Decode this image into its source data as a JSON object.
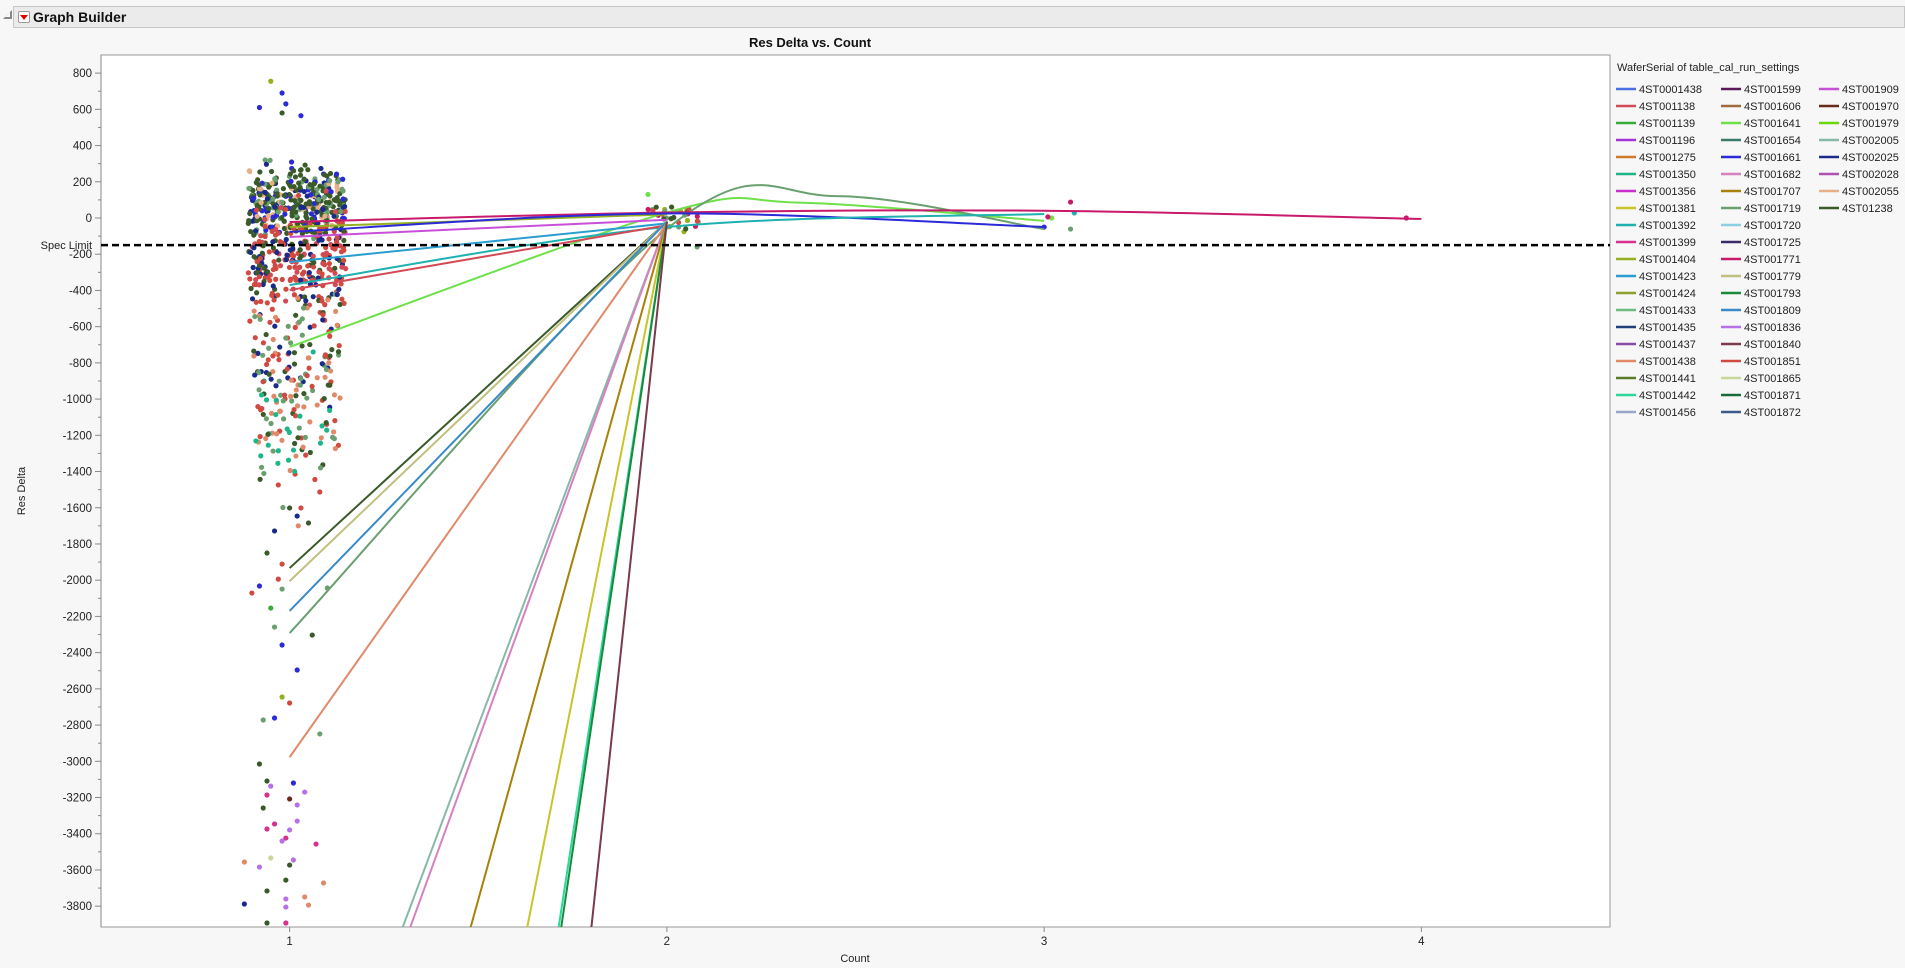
{
  "header": {
    "title": "Graph Builder"
  },
  "chart_data": {
    "type": "scatter",
    "title": "Res Delta vs. Count",
    "xlabel": "Count",
    "ylabel": "Res Delta",
    "xlim": [
      0.5,
      4.5
    ],
    "ylim": [
      -3915,
      900
    ],
    "x_ticks": [
      1,
      2,
      3,
      4
    ],
    "y_ticks": [
      800,
      600,
      400,
      200,
      0,
      -200,
      -400,
      -600,
      -800,
      -1000,
      -1200,
      -1400,
      -1600,
      -1800,
      -2000,
      -2200,
      -2400,
      -2600,
      -2800,
      -3000,
      -3200,
      -3400,
      -3600,
      -3800
    ],
    "grid": false,
    "reference_line": {
      "label": "Spec Limit",
      "y": -150,
      "style": "dashed",
      "color": "#000000"
    },
    "legend": {
      "title": "WaferSerial of table_cal_run_settings",
      "placement": "right",
      "items": [
        {
          "name": "4ST0001438",
          "color": "#4a6fe0"
        },
        {
          "name": "4ST001138",
          "color": "#d24a55"
        },
        {
          "name": "4ST001139",
          "color": "#3aaa3a"
        },
        {
          "name": "4ST001196",
          "color": "#a233d8"
        },
        {
          "name": "4ST001275",
          "color": "#d0782a"
        },
        {
          "name": "4ST001350",
          "color": "#1fb58a"
        },
        {
          "name": "4ST001356",
          "color": "#c92fc9"
        },
        {
          "name": "4ST001381",
          "color": "#c8c42a"
        },
        {
          "name": "4ST001392",
          "color": "#1fb0b0"
        },
        {
          "name": "4ST001399",
          "color": "#d8308f"
        },
        {
          "name": "4ST001404",
          "color": "#94b020"
        },
        {
          "name": "4ST001423",
          "color": "#2a9ed0"
        },
        {
          "name": "4ST001424",
          "color": "#8ea02a"
        },
        {
          "name": "4ST001433",
          "color": "#6dbb80"
        },
        {
          "name": "4ST001435",
          "color": "#1f3f7a"
        },
        {
          "name": "4ST001437",
          "color": "#8a4aa8"
        },
        {
          "name": "4ST001438",
          "color": "#e08a6a"
        },
        {
          "name": "4ST001441",
          "color": "#5a7a2a"
        },
        {
          "name": "4ST001442",
          "color": "#2ad89a"
        },
        {
          "name": "4ST001456",
          "color": "#9aa6c8"
        },
        {
          "name": "4ST001599",
          "color": "#5a1a5a"
        },
        {
          "name": "4ST001606",
          "color": "#a06a3a"
        },
        {
          "name": "4ST001641",
          "color": "#6ee04a"
        },
        {
          "name": "4ST001654",
          "color": "#3a7a6a"
        },
        {
          "name": "4ST001661",
          "color": "#2a2ad8"
        },
        {
          "name": "4ST001682",
          "color": "#d880c0"
        },
        {
          "name": "4ST001707",
          "color": "#a8800a"
        },
        {
          "name": "4ST001719",
          "color": "#6aa070"
        },
        {
          "name": "4ST001720",
          "color": "#8ad0e0"
        },
        {
          "name": "4ST001725",
          "color": "#3a2a6a"
        },
        {
          "name": "4ST001771",
          "color": "#c81a6a"
        },
        {
          "name": "4ST001779",
          "color": "#c0c080"
        },
        {
          "name": "4ST001793",
          "color": "#1a8a3a"
        },
        {
          "name": "4ST001809",
          "color": "#3a8ac8"
        },
        {
          "name": "4ST001836",
          "color": "#b870e8"
        },
        {
          "name": "4ST001840",
          "color": "#7a3a4a"
        },
        {
          "name": "4ST001851",
          "color": "#d04a40"
        },
        {
          "name": "4ST001865",
          "color": "#c8d898"
        },
        {
          "name": "4ST001871",
          "color": "#1a6a3a"
        },
        {
          "name": "4ST001872",
          "color": "#3a5a8a"
        },
        {
          "name": "4ST001909",
          "color": "#c850d8"
        },
        {
          "name": "4ST001970",
          "color": "#6a2a1a"
        },
        {
          "name": "4ST001979",
          "color": "#6ad80a"
        },
        {
          "name": "4ST002005",
          "color": "#88b8a8"
        },
        {
          "name": "4ST002025",
          "color": "#1a2a8a"
        },
        {
          "name": "4ST002028",
          "color": "#b050b0"
        },
        {
          "name": "4ST002055",
          "color": "#e8b088"
        },
        {
          "name": "4ST01238",
          "color": "#3a5a2a"
        }
      ]
    },
    "series_lines": [
      {
        "name": "4ST001641",
        "x": [
          1,
          2,
          2.35,
          3
        ],
        "y": [
          -712,
          30,
          85,
          -16
        ]
      },
      {
        "name": "4ST001719",
        "x": [
          1,
          2,
          2.45,
          3
        ],
        "y": [
          -2292,
          -60,
          121,
          -61
        ]
      },
      {
        "name": "4ST001771",
        "x": [
          1,
          2,
          3,
          4
        ],
        "y": [
          -22,
          30,
          40,
          -5
        ]
      },
      {
        "name": "4ST001404",
        "x": [
          1,
          2
        ],
        "y": [
          -50,
          20
        ]
      },
      {
        "name": "4ST001661",
        "x": [
          1,
          2,
          3
        ],
        "y": [
          -77,
          25,
          -50
        ]
      },
      {
        "name": "4ST001909",
        "x": [
          1,
          2
        ],
        "y": [
          -105,
          -10
        ]
      },
      {
        "name": "4ST001423",
        "x": [
          1,
          2
        ],
        "y": [
          -243,
          -30
        ]
      },
      {
        "name": "4ST001392",
        "x": [
          1,
          2,
          3
        ],
        "y": [
          -370,
          -50,
          22
        ]
      },
      {
        "name": "4ST001138",
        "x": [
          1,
          2
        ],
        "y": [
          -398,
          -40
        ]
      },
      {
        "name": "4ST01238",
        "x": [
          1,
          2
        ],
        "y": [
          -1933,
          -20
        ]
      },
      {
        "name": "4ST001779",
        "x": [
          1,
          2
        ],
        "y": [
          -2005,
          -20
        ]
      },
      {
        "name": "4ST001809",
        "x": [
          1,
          2
        ],
        "y": [
          -2170,
          -20
        ]
      },
      {
        "name": "4ST001438",
        "x": [
          1,
          2
        ],
        "y": [
          -2977,
          -30
        ]
      },
      {
        "name": "4ST002005",
        "x": [
          1,
          2
        ],
        "y": [
          -5584,
          -20
        ]
      },
      {
        "name": "4ST001682",
        "x": [
          1,
          2
        ],
        "y": [
          -5748,
          -20
        ]
      },
      {
        "name": "4ST001707",
        "x": [
          1,
          2
        ],
        "y": [
          -7510,
          -20
        ]
      },
      {
        "name": "4ST001381",
        "x": [
          1,
          2
        ],
        "y": [
          -10547,
          -20
        ]
      },
      {
        "name": "4ST001442",
        "x": [
          1,
          2
        ],
        "y": [
          -13600,
          -20
        ]
      },
      {
        "name": "4ST001793",
        "x": [
          1,
          2
        ],
        "y": [
          -13930,
          -20
        ]
      },
      {
        "name": "4ST001840",
        "x": [
          1,
          2
        ],
        "y": [
          -19495,
          -20
        ]
      }
    ],
    "point_clusters": [
      {
        "x": 1,
        "x_jitter": 0.13,
        "y_mean": 80,
        "y_sd": 90,
        "n": 360,
        "series": [
          "4ST01238",
          "4ST01238",
          "4ST01238",
          "4ST001661",
          "4ST002055",
          "4ST001719",
          "4ST002025"
        ]
      },
      {
        "x": 1,
        "x_jitter": 0.13,
        "y_mean": -250,
        "y_sd": 150,
        "n": 260,
        "series": [
          "4ST001851",
          "4ST01238",
          "4ST002025",
          "4ST001138",
          "4ST001851"
        ]
      },
      {
        "x": 1,
        "x_jitter": 0.12,
        "y_mean": -700,
        "y_sd": 200,
        "n": 120,
        "series": [
          "4ST002025",
          "4ST01238",
          "4ST001851",
          "4ST001719",
          "4ST001438"
        ]
      },
      {
        "x": 1,
        "x_jitter": 0.11,
        "y_mean": -1150,
        "y_sd": 200,
        "n": 90,
        "series": [
          "4ST001851",
          "4ST001438",
          "4ST001719",
          "4ST01238",
          "4ST001350"
        ]
      },
      {
        "x": 2,
        "x_jitter": 0.07,
        "y_mean": 10,
        "y_sd": 35,
        "n": 30,
        "series": [
          "4ST001851",
          "4ST001771",
          "4ST001404",
          "4ST001423",
          "4ST002005",
          "4ST01238",
          "4ST001719"
        ]
      }
    ],
    "points": [
      [
        0.95,
        755,
        "4ST001404"
      ],
      [
        0.98,
        690,
        "4ST001661"
      ],
      [
        0.92,
        610,
        "4ST001661"
      ],
      [
        0.99,
        630,
        "4ST001661"
      ],
      [
        0.98,
        580,
        "4ST01238"
      ],
      [
        1.03,
        565,
        "4ST001661"
      ],
      [
        0.97,
        -1474,
        "4ST001851"
      ],
      [
        1.08,
        -1513,
        "4ST001851"
      ],
      [
        1.0,
        -1601,
        "4ST01238"
      ],
      [
        1.03,
        -1601,
        "4ST001851"
      ],
      [
        1.02,
        -1646,
        "4ST002025"
      ],
      [
        0.96,
        -1728,
        "4ST002025"
      ],
      [
        1.05,
        -1684,
        "4ST01238"
      ],
      [
        0.94,
        -1850,
        "4ST01238"
      ],
      [
        0.98,
        -1911,
        "4ST001851"
      ],
      [
        0.92,
        -2032,
        "4ST001661"
      ],
      [
        0.9,
        -2071,
        "4ST001851"
      ],
      [
        0.97,
        -1994,
        "4ST001851"
      ],
      [
        0.98,
        -2049,
        "4ST001719"
      ],
      [
        1.06,
        -2303,
        "4ST01238"
      ],
      [
        0.96,
        -2259,
        "4ST001719"
      ],
      [
        1.1,
        -2043,
        "4ST001719"
      ],
      [
        0.95,
        -2154,
        "4ST001139"
      ],
      [
        0.98,
        -2358,
        "4ST001661"
      ],
      [
        1.02,
        -2496,
        "4ST001661"
      ],
      [
        0.98,
        -2645,
        "4ST001404"
      ],
      [
        1.0,
        -2678,
        "4ST001851"
      ],
      [
        0.96,
        -2761,
        "4ST001661"
      ],
      [
        0.93,
        -2772,
        "4ST001719"
      ],
      [
        1.08,
        -2849,
        "4ST001719"
      ],
      [
        0.92,
        -3015,
        "4ST01238"
      ],
      [
        0.94,
        -3109,
        "4ST01238"
      ],
      [
        0.95,
        -3137,
        "4ST001836"
      ],
      [
        1.01,
        -3120,
        "4ST001661"
      ],
      [
        1.04,
        -3170,
        "4ST001836"
      ],
      [
        0.94,
        -3186,
        "4ST001399"
      ],
      [
        1.0,
        -3208,
        "4ST001970"
      ],
      [
        0.93,
        -3258,
        "4ST01238"
      ],
      [
        1.02,
        -3241,
        "4ST001836"
      ],
      [
        1.02,
        -3330,
        "4ST001836"
      ],
      [
        0.96,
        -3346,
        "4ST001399"
      ],
      [
        0.94,
        -3374,
        "4ST001399"
      ],
      [
        1.0,
        -3379,
        "4ST001836"
      ],
      [
        0.99,
        -3424,
        "4ST001399"
      ],
      [
        0.98,
        -3440,
        "4ST001836"
      ],
      [
        1.07,
        -3457,
        "4ST001399"
      ],
      [
        0.88,
        -3556,
        "4ST001438"
      ],
      [
        0.95,
        -3534,
        "4ST001865"
      ],
      [
        0.92,
        -3584,
        "4ST001836"
      ],
      [
        1.01,
        -3545,
        "4ST001836"
      ],
      [
        1.0,
        -3573,
        "4ST01238"
      ],
      [
        0.99,
        -3656,
        "4ST01238"
      ],
      [
        1.09,
        -3672,
        "4ST001438"
      ],
      [
        0.94,
        -3716,
        "4ST01238"
      ],
      [
        1.04,
        -3749,
        "4ST001438"
      ],
      [
        0.99,
        -3760,
        "4ST001836"
      ],
      [
        0.88,
        -3788,
        "4ST002025"
      ],
      [
        1.05,
        -3794,
        "4ST001438"
      ],
      [
        0.99,
        -3805,
        "4ST001836"
      ],
      [
        0.94,
        -3893,
        "4ST01238"
      ],
      [
        0.99,
        -3893,
        "4ST001399"
      ],
      [
        1.95,
        130,
        "4ST001641"
      ],
      [
        2.08,
        -160,
        "4ST001719"
      ],
      [
        2.05,
        -60,
        "4ST01238"
      ],
      [
        3.07,
        88,
        "4ST001771"
      ],
      [
        3.08,
        28,
        "4ST001392"
      ],
      [
        3.07,
        -61,
        "4ST001719"
      ],
      [
        3.02,
        0,
        "4ST001641"
      ],
      [
        3.01,
        6,
        "4ST001771"
      ],
      [
        3.0,
        -50,
        "4ST001661"
      ],
      [
        3.96,
        0,
        "4ST001771"
      ]
    ]
  }
}
